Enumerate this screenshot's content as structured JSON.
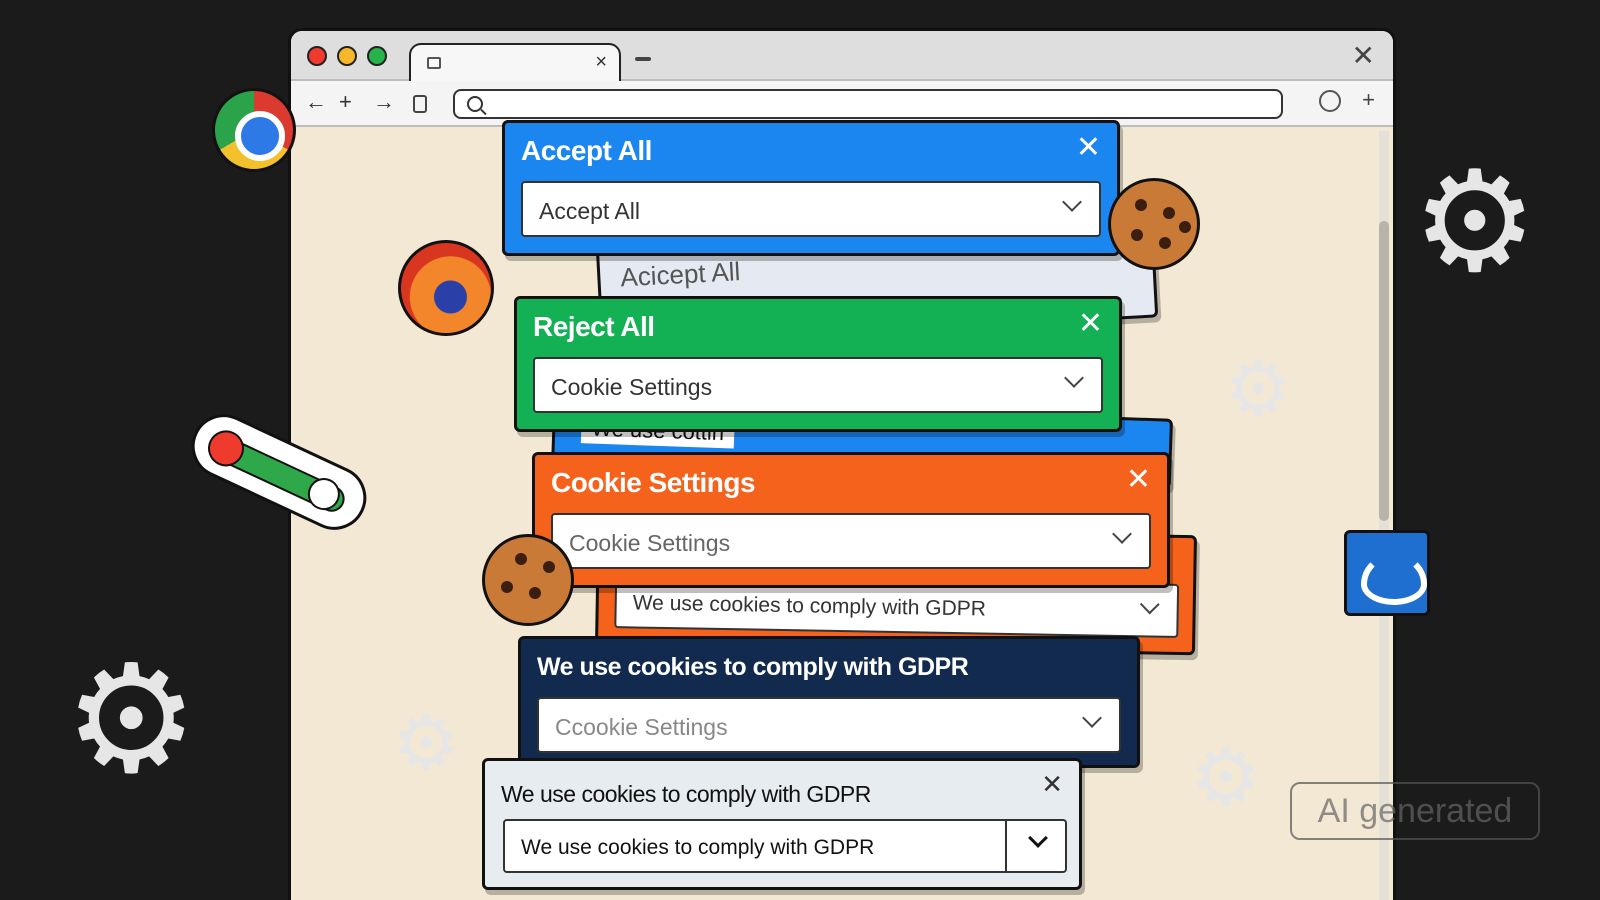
{
  "browser": {
    "tab_close": "×",
    "window_close": "✕",
    "nav": {
      "back": "←",
      "new": "+",
      "forward": "→",
      "more": "+"
    }
  },
  "peek_cards": {
    "accept_peek": "Acicept All",
    "cookies_peek": "We use cottin"
  },
  "dialogs": [
    {
      "title": "Accept All",
      "close": "✕",
      "select_value": "Accept All",
      "color": "#1c86f0"
    },
    {
      "title": "Reject All",
      "close": "✕",
      "select_value": "Cookie Settings",
      "color": "#13b054"
    },
    {
      "title": "Cookie Settings",
      "close": "✕",
      "select_value": "Cookie Settings",
      "color": "#f5621b"
    },
    {
      "title": "",
      "close": "",
      "select_value": "We use cookies to comply with GDPR",
      "color": "#f5621b"
    },
    {
      "title": "We use cookies to comply with GDPR",
      "close": "",
      "select_value": "Ccookie Settings",
      "color": "#112a4d"
    },
    {
      "title": "We use cookies to comply with GDPR",
      "close": "✕",
      "select_value": "We use cookies to comply with GDPR",
      "color": "#e7ecf0"
    }
  ],
  "watermark": "AI generated",
  "icons": [
    "chrome-icon",
    "firefox-icon",
    "cookie-icon",
    "gear-icon",
    "toggle-icon",
    "edge-icon"
  ]
}
